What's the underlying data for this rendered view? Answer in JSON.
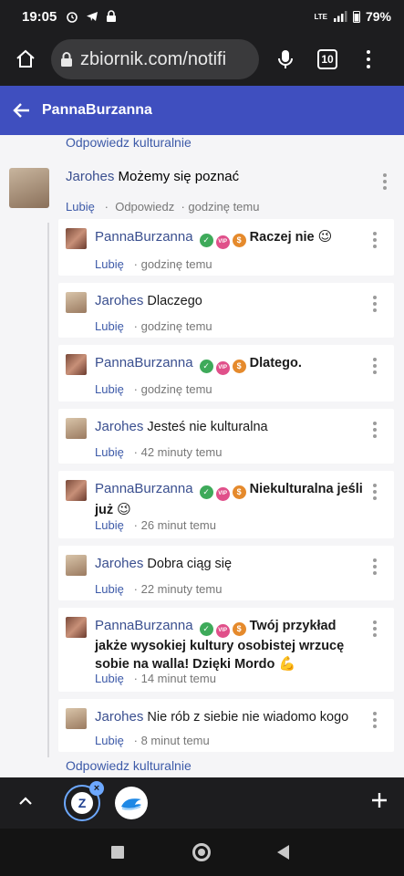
{
  "status_bar": {
    "time": "19:05",
    "battery": "79%",
    "network": "LTE"
  },
  "browser": {
    "url": "zbiornik.com/notifi",
    "tab_count": "10"
  },
  "header": {
    "title": "PannaBurzanna"
  },
  "thread": {
    "reply_link_top": "Odpowiedz kulturalnie",
    "reply_link_bottom": "Odpowiedz kulturalnie",
    "parent": {
      "author": "Jarohes",
      "text": "Możemy się poznać",
      "like": "Lubię",
      "reply": "Odpowiedz",
      "time": "godzinę temu"
    },
    "replies": [
      {
        "author": "PannaBurzanna",
        "text": "Raczej nie",
        "emoji": "😉",
        "like": "Lubię",
        "time": "godzinę temu"
      },
      {
        "author": "Jarohes",
        "text": "Dlaczego",
        "like": "Lubię",
        "time": "godzinę temu"
      },
      {
        "author": "PannaBurzanna",
        "text": "Dlatego.",
        "like": "Lubię",
        "time": "godzinę temu"
      },
      {
        "author": "Jarohes",
        "text": "Jesteś nie kulturalna",
        "like": "Lubię",
        "time": "42 minuty temu"
      },
      {
        "author": "PannaBurzanna",
        "text": "Niekulturalna jeśli już",
        "emoji": "😉",
        "like": "Lubię",
        "time": "26 minut temu"
      },
      {
        "author": "Jarohes",
        "text": "Dobra ciąg się",
        "like": "Lubię",
        "time": "22 minuty temu"
      },
      {
        "author": "PannaBurzanna",
        "text": "Twój przykład jakże wysokiej kultury osobistej wrzucę sobie na walla! Dzięki Mordo",
        "emoji": "💪",
        "like": "Lubię",
        "time": "14 minut temu"
      },
      {
        "author": "Jarohes",
        "text": "Nie rób z siebie nie wiadomo kogo",
        "like": "Lubię",
        "time": "8 minut temu"
      }
    ],
    "badges": {
      "vip": "VIP",
      "dollar": "$",
      "check": "✓"
    }
  },
  "bottom_bar": {
    "tab1_letter": "Z",
    "tab1_close": "×"
  },
  "colors": {
    "header_bg": "#3f4fbf",
    "link": "#3d5aa8",
    "verified": "#3eaa5a",
    "vip": "#e0508a",
    "dollar": "#e58a2c"
  }
}
